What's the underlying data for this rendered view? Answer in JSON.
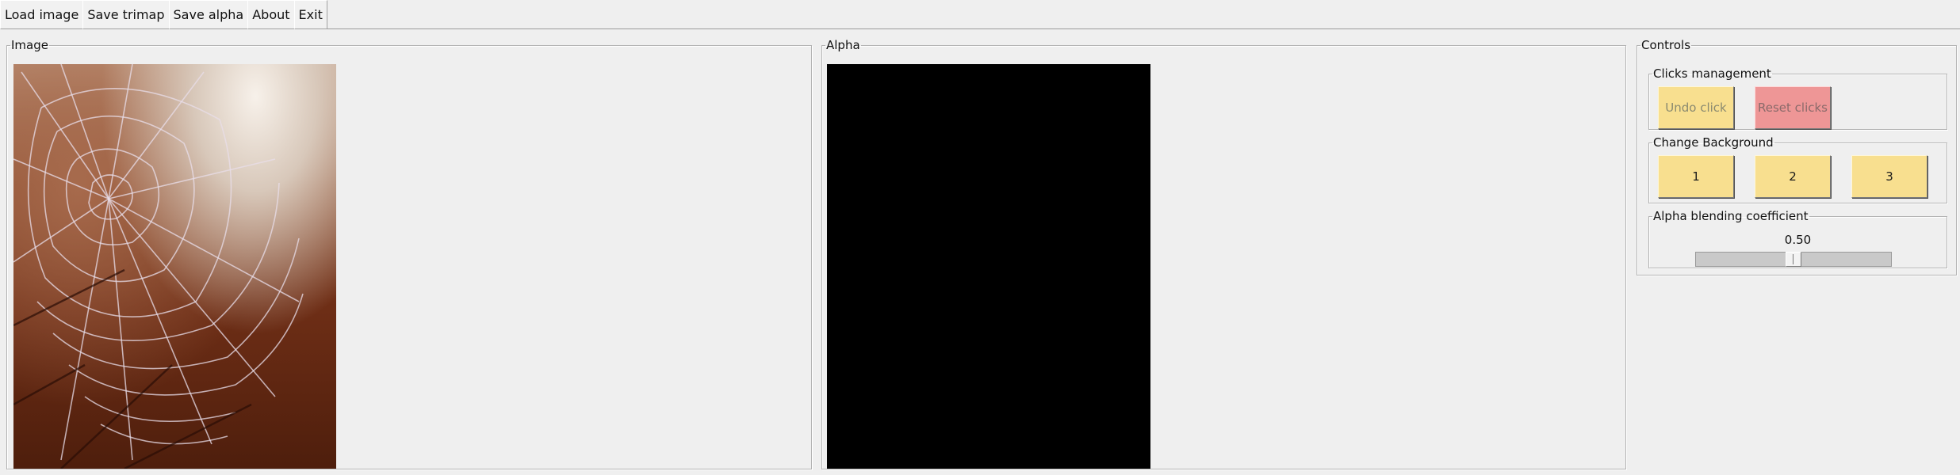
{
  "toolbar": {
    "load_image": "Load image",
    "save_trimap": "Save trimap",
    "save_alpha": "Save alpha",
    "about": "About",
    "exit": "Exit"
  },
  "panels": {
    "image_title": "Image",
    "alpha_title": "Alpha",
    "controls_title": "Controls"
  },
  "controls": {
    "clicks_management": {
      "title": "Clicks management",
      "undo_label": "Undo click",
      "reset_label": "Reset clicks"
    },
    "change_background": {
      "title": "Change Background",
      "options": [
        "1",
        "2",
        "3"
      ]
    },
    "alpha_blending": {
      "title": "Alpha blending coefficient",
      "value_text": "0.50",
      "value": 0.5
    }
  },
  "colors": {
    "window_bg": "#efefef",
    "yellow_button": "#f8df8f",
    "red_button": "#ee9696",
    "alpha_canvas": "#000000"
  },
  "icons": {
    "image_content": "spider-web-photo"
  }
}
